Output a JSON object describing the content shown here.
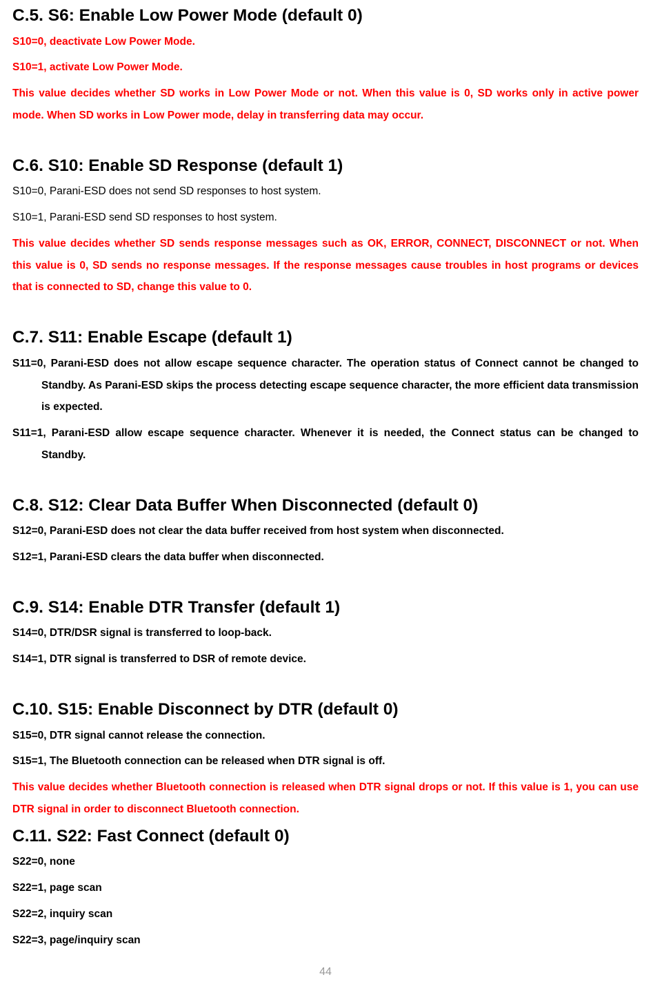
{
  "sections": {
    "c5": {
      "heading": "C.5. S6: Enable Low Power Mode (default 0)",
      "line1": "S10=0, deactivate Low Power Mode.",
      "line2": "S10=1, activate Low Power Mode.",
      "para": "This value decides whether SD works in Low Power Mode or not. When this value is 0, SD works only in active power mode. When SD works in Low Power mode, delay in transferring data may occur."
    },
    "c6": {
      "heading": "C.6. S10: Enable SD Response (default 1)",
      "line1": "S10=0, Parani-ESD does not send SD responses to host system.",
      "line2": "S10=1, Parani-ESD send SD responses to host system.",
      "para": "This value decides whether SD sends response messages such as OK, ERROR, CONNECT, DISCONNECT or not. When this value is 0, SD sends no response messages. If the response messages cause troubles in host programs or devices that is connected to SD, change this value to 0."
    },
    "c7": {
      "heading": "C.7. S11: Enable Escape (default 1)",
      "line1": "S11=0, Parani-ESD does not allow escape sequence character. The operation status of Connect cannot be changed to Standby. As Parani-ESD skips the process detecting escape sequence character, the more efficient data transmission is expected.",
      "line2": "S11=1, Parani-ESD allow escape sequence character. Whenever it is needed, the Connect status can be changed to Standby."
    },
    "c8": {
      "heading": "C.8. S12: Clear Data Buffer When Disconnected (default 0)",
      "line1": "S12=0, Parani-ESD does not clear the data buffer received from host system when disconnected.",
      "line2": "S12=1, Parani-ESD clears the data buffer when disconnected."
    },
    "c9": {
      "heading": "C.9. S14: Enable DTR Transfer (default 1)",
      "line1": "S14=0, DTR/DSR signal is transferred to loop-back.",
      "line2": "S14=1, DTR signal is transferred to DSR of remote device."
    },
    "c10": {
      "heading": "C.10. S15: Enable Disconnect by DTR (default 0)",
      "line1": "S15=0, DTR signal cannot release the connection.",
      "line2": "S15=1, The Bluetooth connection can be released when DTR signal is off.",
      "para": "This value decides whether Bluetooth connection is released when DTR signal drops or not. If this value is 1, you can use DTR signal in order to disconnect Bluetooth connection."
    },
    "c11": {
      "heading": "C.11. S22: Fast Connect (default 0)",
      "line1": "S22=0, none",
      "line2": "S22=1, page scan",
      "line3": "S22=2, inquiry scan",
      "line4": "S22=3, page/inquiry scan"
    }
  },
  "pageNumber": "44"
}
